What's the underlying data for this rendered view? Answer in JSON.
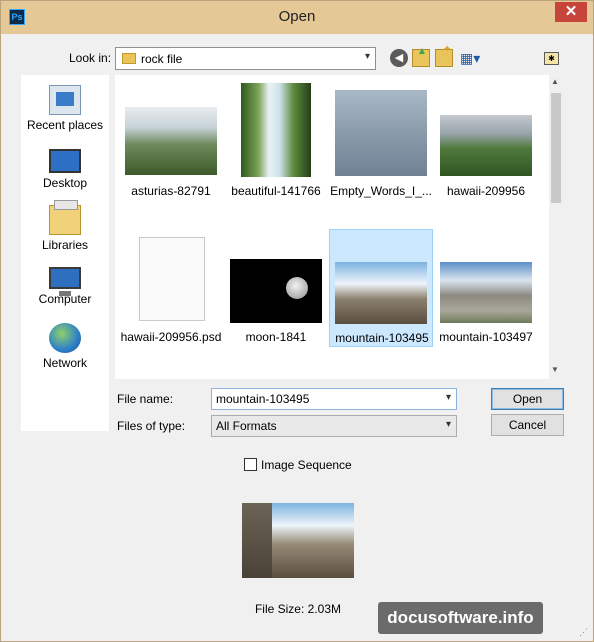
{
  "window": {
    "title": "Open",
    "app_icon_text": "Ps",
    "close_glyph": "✕"
  },
  "toolbar": {
    "lookin_label": "Look in:",
    "lookin_value": "rock file",
    "back_glyph": "◀",
    "view_glyph": "▦▾",
    "right_glyph": "✱"
  },
  "places": [
    {
      "label": "Recent places",
      "icon": "recent-places-icon"
    },
    {
      "label": "Desktop",
      "icon": "desktop-icon"
    },
    {
      "label": "Libraries",
      "icon": "libraries-icon"
    },
    {
      "label": "Computer",
      "icon": "computer-icon"
    },
    {
      "label": "Network",
      "icon": "network-icon"
    }
  ],
  "files": [
    {
      "name": "asturias-82791"
    },
    {
      "name": "beautiful-141766"
    },
    {
      "name": "Empty_Words_I_..."
    },
    {
      "name": "hawaii-209956"
    },
    {
      "name": "hawaii-209956.psd"
    },
    {
      "name": "moon-1841"
    },
    {
      "name": "mountain-103495",
      "selected": true
    },
    {
      "name": "mountain-103497"
    }
  ],
  "form": {
    "filename_label": "File name:",
    "filename_value": "mountain-103495",
    "filetype_label": "Files of type:",
    "filetype_value": "All Formats",
    "open_label": "Open",
    "cancel_label": "Cancel",
    "arrow_glyph": "▾"
  },
  "options": {
    "image_sequence_label": "Image Sequence",
    "image_sequence_checked": false
  },
  "preview": {
    "file_size": "File Size: 2.03M"
  },
  "watermark": {
    "text": "docusoftware.info"
  },
  "colors": {
    "titlebar": "#e4c896",
    "selection": "#cce8ff",
    "close_button": "#c7443a"
  }
}
